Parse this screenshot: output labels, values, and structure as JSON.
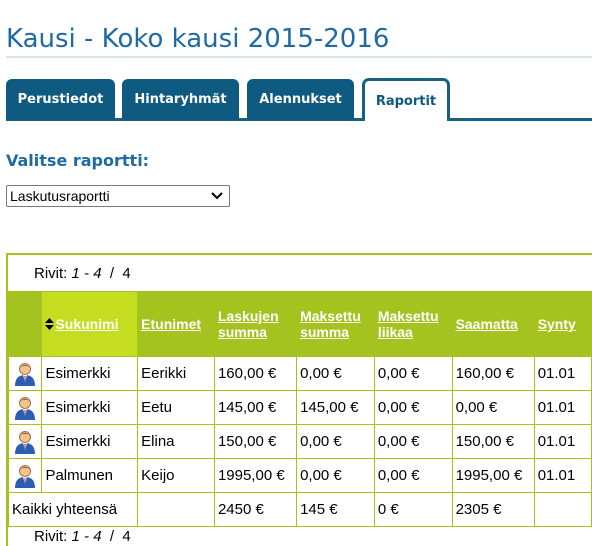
{
  "page": {
    "title": "Kausi - Koko kausi 2015-2016"
  },
  "tabs": [
    {
      "label": "Perustiedot",
      "active": false
    },
    {
      "label": "Hintaryhmät",
      "active": false
    },
    {
      "label": "Alennukset",
      "active": false
    },
    {
      "label": "Raportit",
      "active": true
    }
  ],
  "report_select": {
    "label": "Valitse raportti:",
    "value": "Laskutusraportti"
  },
  "pager": {
    "prefix": "Rivit:",
    "range": "1 - 4",
    "separator": "/",
    "total": "4"
  },
  "table": {
    "columns": [
      {
        "label": "Sukunimi"
      },
      {
        "label": "Etunimet"
      },
      {
        "label": "Laskujen summa"
      },
      {
        "label": "Maksettu summa"
      },
      {
        "label": "Maksettu liikaa"
      },
      {
        "label": "Saamatta"
      },
      {
        "label": "Synty"
      }
    ],
    "rows": [
      {
        "cells": [
          "Esimerkki",
          "Eerikki",
          "160,00 €",
          "0,00 €",
          "0,00 €",
          "160,00 €",
          "01.01"
        ]
      },
      {
        "cells": [
          "Esimerkki",
          "Eetu",
          "145,00 €",
          "145,00 €",
          "0,00 €",
          "0,00 €",
          "01.01"
        ]
      },
      {
        "cells": [
          "Esimerkki",
          "Elina",
          "150,00 €",
          "0,00 €",
          "0,00 €",
          "150,00 €",
          "01.01"
        ]
      },
      {
        "cells": [
          "Palmunen",
          "Keijo",
          "1995,00 €",
          "0,00 €",
          "0,00 €",
          "1995,00 €",
          "01.01"
        ]
      }
    ],
    "total": {
      "label": "Kaikki yhteensä",
      "cells": [
        "2450 €",
        "145 €",
        "0 €",
        "2305 €",
        ""
      ]
    }
  },
  "colors": {
    "accent_blue": "#1f6aa3",
    "tab_dark": "#0f5a80",
    "table_green": "#a4c31f",
    "sorted_green": "#c4dd20"
  },
  "icons": {
    "row_icon": "person-icon",
    "select_icon": "chevron-down-icon",
    "sort_icon": "sort-arrows-icon"
  }
}
